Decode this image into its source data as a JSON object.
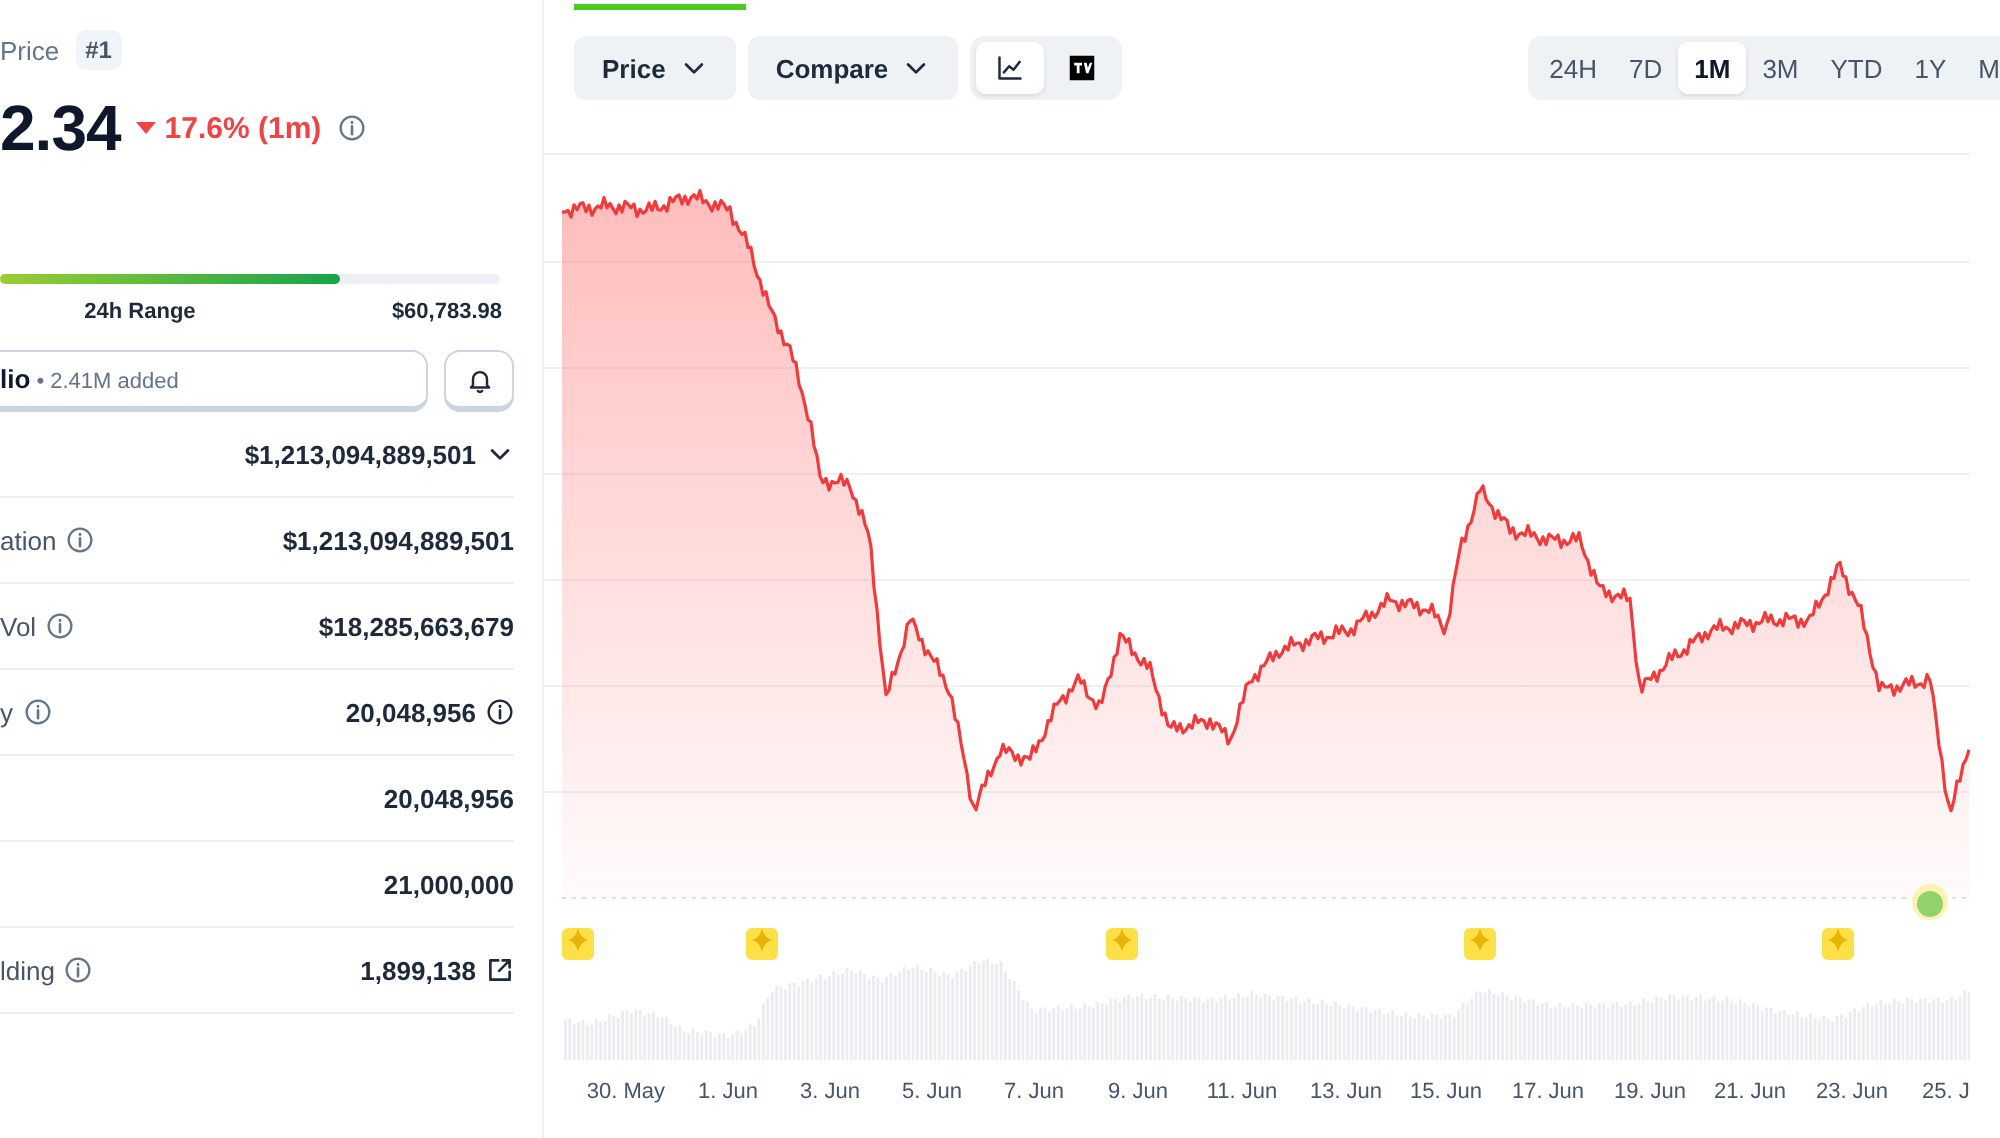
{
  "header": {
    "title": "Price",
    "rank": "#1"
  },
  "price": {
    "value": "2.34",
    "change": "17.6% (1m)",
    "falling": true
  },
  "range": {
    "level": 0.68,
    "label": "24h Range",
    "high": "$60,783.98"
  },
  "portfolio": {
    "label": "lio",
    "added": "• 2.41M added"
  },
  "stats": [
    {
      "kind": "dropdown",
      "value": "$1,213,094,889,501",
      "label_info": false
    },
    {
      "kind": "plain",
      "label": "ation",
      "value": "$1,213,094,889,501",
      "label_info": true
    },
    {
      "kind": "plain",
      "label": "Vol",
      "value": "$18,285,663,679",
      "label_info": true
    },
    {
      "kind": "info",
      "label": "y",
      "value": "20,048,956",
      "label_info": true
    },
    {
      "kind": "plain",
      "value": "20,048,956",
      "label_info": false
    },
    {
      "kind": "plain",
      "value": "21,000,000",
      "label_info": false
    },
    {
      "kind": "link",
      "label": "lding",
      "value": "1,899,138",
      "label_info": true
    }
  ],
  "chart_controls": {
    "dropdowns": [
      "Price",
      "Compare"
    ],
    "views": [
      {
        "kind": "line",
        "selected": true
      },
      {
        "kind": "tradingview",
        "selected": false
      }
    ],
    "ranges": [
      {
        "label": "24H",
        "selected": false
      },
      {
        "label": "7D",
        "selected": false
      },
      {
        "label": "1M",
        "selected": true
      },
      {
        "label": "3M",
        "selected": false
      },
      {
        "label": "YTD",
        "selected": false
      },
      {
        "label": "1Y",
        "selected": false
      },
      {
        "label": "M",
        "selected": false
      }
    ]
  },
  "chart": {
    "x_labels": [
      "30. May",
      "1. Jun",
      "3. Jun",
      "5. Jun",
      "7. Jun",
      "9. Jun",
      "11. Jun",
      "13. Jun",
      "15. Jun",
      "17. Jun",
      "19. Jun",
      "21. Jun",
      "23. Jun",
      "25. J"
    ]
  }
}
